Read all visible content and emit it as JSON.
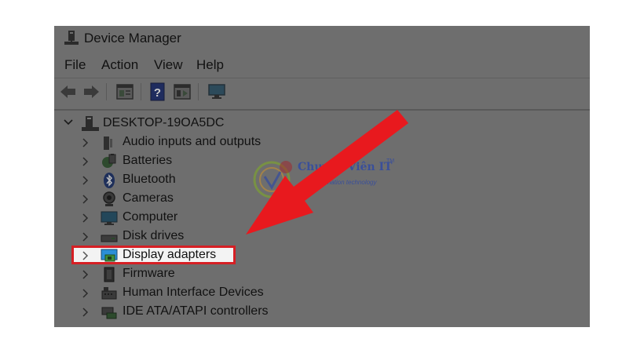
{
  "window": {
    "title": "Device Manager"
  },
  "menu": [
    {
      "label": "File"
    },
    {
      "label": "Action"
    },
    {
      "label": "View"
    },
    {
      "label": "Help"
    }
  ],
  "toolbar": {
    "buttons": [
      "back-icon",
      "forward-icon",
      "properties-icon",
      "help-icon",
      "view-icon",
      "monitor-icon"
    ]
  },
  "tree": {
    "root": {
      "label": "DESKTOP-19OA5DC",
      "icon": "computer-tower-icon",
      "expanded": true
    },
    "items": [
      {
        "label": "Audio inputs and outputs",
        "icon": "speaker-icon"
      },
      {
        "label": "Batteries",
        "icon": "battery-icon"
      },
      {
        "label": "Bluetooth",
        "icon": "bluetooth-icon"
      },
      {
        "label": "Cameras",
        "icon": "camera-icon"
      },
      {
        "label": "Computer",
        "icon": "monitor-icon"
      },
      {
        "label": "Disk drives",
        "icon": "disk-drive-icon"
      },
      {
        "label": "Display adapters",
        "icon": "display-adapter-icon",
        "highlighted": true
      },
      {
        "label": "Firmware",
        "icon": "chip-icon"
      },
      {
        "label": "Human Interface Devices",
        "icon": "hid-icon"
      },
      {
        "label": "IDE ATA/ATAPI controllers",
        "icon": "ide-controller-icon"
      }
    ]
  },
  "annotation": {
    "highlight_color": "#d61f24",
    "arrow_color": "#e8191e"
  },
  "watermark": {
    "name": "Chuyên Viên IT",
    "tm": "TM",
    "tagline": "information technology"
  }
}
